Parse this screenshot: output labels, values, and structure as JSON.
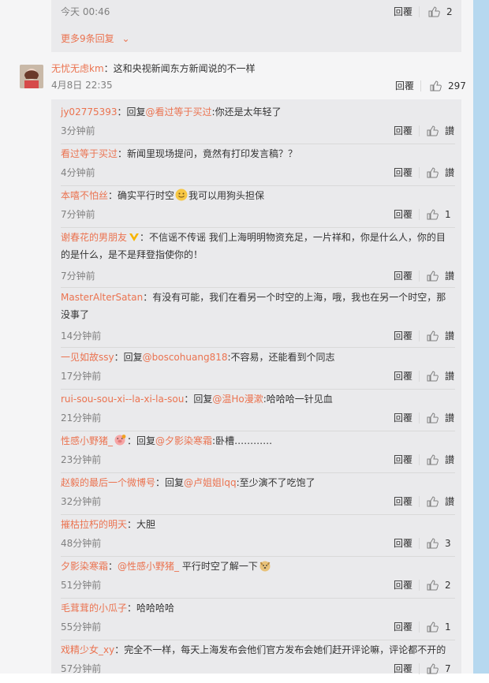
{
  "top_reply": {
    "time": "今天 00:46",
    "reply_label": "回覆",
    "likes": "2",
    "more_replies": "更多9条回复"
  },
  "main_comment": {
    "user": "无忧无虑km",
    "text": "：这和央视新闻东方新闻说的不一样",
    "time": "4月8日 22:35",
    "reply_label": "回覆",
    "likes": "297"
  },
  "replies": [
    {
      "user": "jy02775393",
      "pre": "：回复",
      "mention": "@看过等于买过",
      "text": ":你还是太年轻了",
      "time": "3分钟前",
      "reply_label": "回覆",
      "likes": "讃"
    },
    {
      "user": "看过等于买过",
      "pre": "：新闻里现场提问，竟然有打印发言稿？？",
      "mention": "",
      "text": "",
      "time": "4分钟前",
      "reply_label": "回覆",
      "likes": "讃"
    },
    {
      "user": "本嘻不怕丝",
      "pre": "：确实平行时空",
      "mention": "",
      "text": "我可以用狗头担保",
      "time": "7分钟前",
      "reply_label": "回覆",
      "likes": "1"
    },
    {
      "user": "谢春花的男朋友",
      "pre": "：不信谣不传谣 我们上海明明物资充足，一片祥和，你是什么人，你的目的是什么，是不是拜登指使你的！",
      "mention": "",
      "text": "",
      "time": "7分钟前",
      "reply_label": "回覆",
      "likes": "讃"
    },
    {
      "user": "MasterAlterSatan",
      "pre": "：有没有可能，我们在看另一个时空的上海，哦，我也在另一个时空，那没事了",
      "mention": "",
      "text": "",
      "time": "14分钟前",
      "reply_label": "回覆",
      "likes": "讃"
    },
    {
      "user": "一见如故ssy",
      "pre": "：回复",
      "mention": "@boscohuang818",
      "text": ":不容易，还能看到个同志",
      "time": "17分钟前",
      "reply_label": "回覆",
      "likes": "讃"
    },
    {
      "user": "rui-sou-sou-xi--la-xi-la-sou",
      "pre": "：回复",
      "mention": "@温Ho漫漱",
      "text": ":哈哈哈一针见血",
      "time": "21分钟前",
      "reply_label": "回覆",
      "likes": "讃"
    },
    {
      "user": "性感小野猪_",
      "pre": "：回复",
      "mention": "@夕影染寒霜",
      "text": ":卧槽…………",
      "time": "23分钟前",
      "reply_label": "回覆",
      "likes": "讃"
    },
    {
      "user": "赵毅的最后一个微博号",
      "pre": "：回复",
      "mention": "@卢姐姐lqq",
      "text": ":至少演不了吃饱了",
      "time": "32分钟前",
      "reply_label": "回覆",
      "likes": "讃"
    },
    {
      "user": "摧枯拉朽的明天",
      "pre": "：大胆",
      "mention": "",
      "text": "",
      "time": "48分钟前",
      "reply_label": "回覆",
      "likes": "3"
    },
    {
      "user": "夕影染寒霜",
      "pre": "：",
      "mention": "@性感小野猪_",
      "text": " 平行时空了解一下",
      "time": "51分钟前",
      "reply_label": "回覆",
      "likes": "2"
    },
    {
      "user": "毛茸茸的小瓜子",
      "pre": "：哈哈哈哈",
      "mention": "",
      "text": "",
      "time": "55分钟前",
      "reply_label": "回覆",
      "likes": "1"
    },
    {
      "user": "戏精少女_xy",
      "pre": "：完全不一样，每天上海发布会他们官方发布会她们赶开评论嘛，评论都不开的",
      "mention": "",
      "text": "",
      "time": "57分钟前",
      "reply_label": "回覆",
      "likes": "7"
    }
  ],
  "colors": {
    "accent": "#eb7350",
    "nested_bg": "#eaeaec",
    "page_bg": "#f5f5f6",
    "scroll_strip": "#b6d8ef"
  }
}
